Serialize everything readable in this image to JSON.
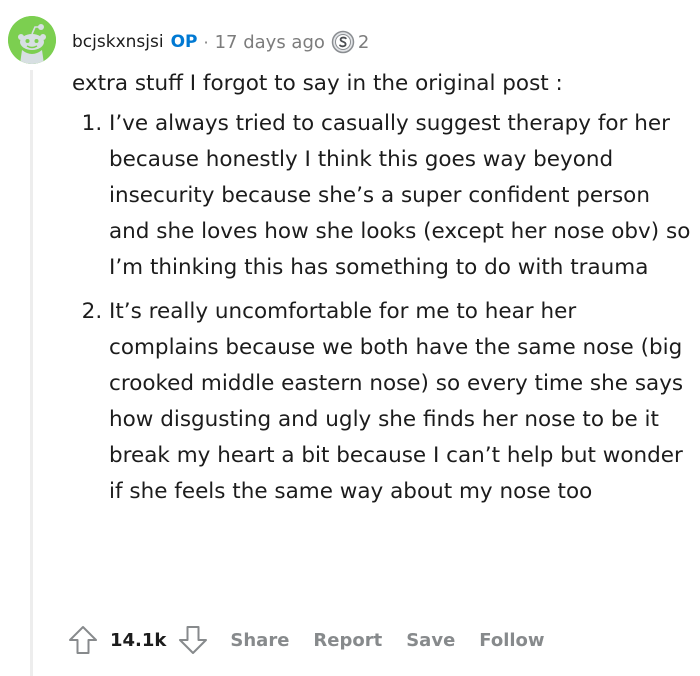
{
  "comment": {
    "username": "bcjskxnsjsi",
    "op_badge": "OP",
    "separator": "·",
    "time_ago": "17 days ago",
    "award_icon": "silver-award-icon",
    "award_count": "2",
    "intro": "extra stuff I forgot to say in the original post :",
    "list_items": [
      "I’ve always tried to casually suggest therapy for her because honestly I think this goes way beyond insecurity because she’s a super confident person and she loves how she looks (except her nose obv) so I’m thinking this has something to do with trauma",
      "It’s really uncomfortable for me to hear her complains because we both have the same nose (big crooked middle eastern nose) so every time she says how disgusting and ugly she finds her nose to be it break my heart a bit because I can’t help but wonder if she feels the same way about my nose too"
    ]
  },
  "actions": {
    "score": "14.1k",
    "share_label": "Share",
    "report_label": "Report",
    "save_label": "Save",
    "follow_label": "Follow"
  },
  "colors": {
    "avatar_bg": "#7ccf50",
    "op_blue": "#0079d3",
    "muted": "#878a8c"
  }
}
